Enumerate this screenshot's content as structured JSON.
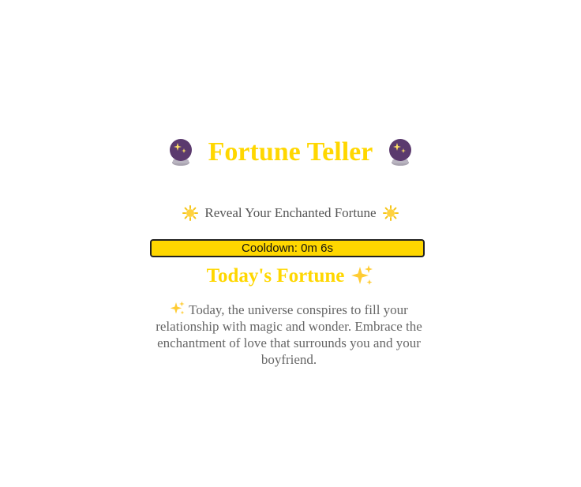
{
  "header": {
    "title": "Fortune Teller",
    "left_icon": "crystal-ball-icon",
    "right_icon": "crystal-ball-icon"
  },
  "subtitle": {
    "text": "Reveal Your Enchanted Fortune",
    "left_icon": "sun-icon",
    "right_icon": "sun-icon"
  },
  "cooldown": {
    "label": "Cooldown: 0m 6s"
  },
  "fortune": {
    "heading": "Today's Fortune",
    "heading_icon": "sparkles-icon",
    "text_icon": "sparkles-icon",
    "text": "Today, the universe conspires to fill your relationship with magic and wonder. Embrace the enchantment of love that surrounds you and your boyfriend."
  },
  "colors": {
    "accent": "#FFD700",
    "text": "#666666",
    "orb": "#5B3A6E",
    "orb_base": "#A9A4B0"
  }
}
